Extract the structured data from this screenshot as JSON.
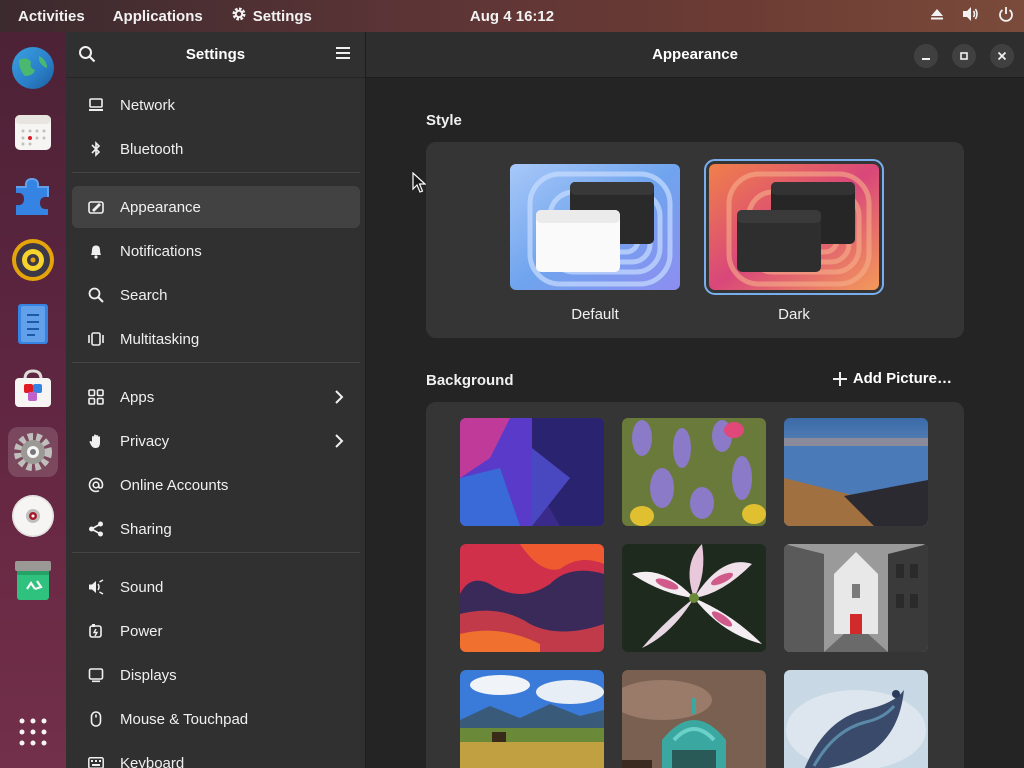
{
  "topbar": {
    "activities": "Activities",
    "applications": "Applications",
    "settings": "Settings",
    "clock": "Aug 4  16:12"
  },
  "dock": {
    "items": [
      "web-browser",
      "calendar",
      "extensions",
      "rhythmbox",
      "text-editor",
      "software",
      "settings",
      "disc",
      "trash",
      "show-apps"
    ]
  },
  "sidebar": {
    "title": "Settings",
    "items": [
      {
        "label": "Network",
        "icon": "network-icon"
      },
      {
        "label": "Bluetooth",
        "icon": "bluetooth-icon"
      },
      {
        "label": "Appearance",
        "icon": "appearance-icon"
      },
      {
        "label": "Notifications",
        "icon": "bell-icon"
      },
      {
        "label": "Search",
        "icon": "search-icon"
      },
      {
        "label": "Multitasking",
        "icon": "multitasking-icon"
      },
      {
        "label": "Apps",
        "icon": "apps-icon"
      },
      {
        "label": "Privacy",
        "icon": "hand-icon"
      },
      {
        "label": "Online Accounts",
        "icon": "at-icon"
      },
      {
        "label": "Sharing",
        "icon": "share-icon"
      },
      {
        "label": "Sound",
        "icon": "speaker-icon"
      },
      {
        "label": "Power",
        "icon": "power-icon"
      },
      {
        "label": "Displays",
        "icon": "display-icon"
      },
      {
        "label": "Mouse & Touchpad",
        "icon": "mouse-icon"
      },
      {
        "label": "Keyboard",
        "icon": "keyboard-icon"
      }
    ]
  },
  "main": {
    "title": "Appearance",
    "style_label": "Style",
    "style_options": [
      "Default",
      "Dark"
    ],
    "selected_style": "Dark",
    "background_label": "Background",
    "add_picture": "Add Picture…"
  },
  "colors": {
    "accent": "#78aeed",
    "sidebar_bg": "#303030",
    "main_bg": "#242424",
    "card_bg": "#353535"
  }
}
